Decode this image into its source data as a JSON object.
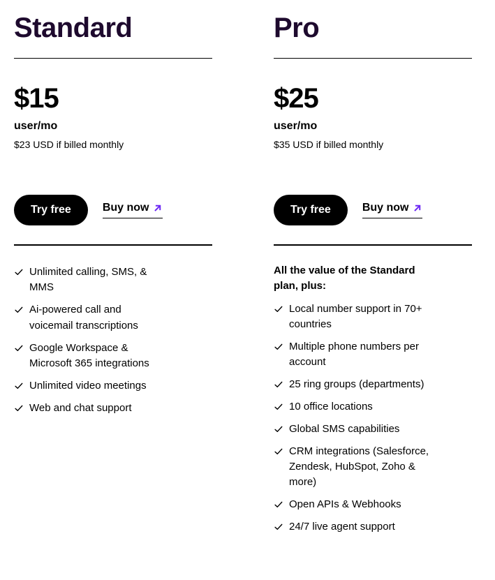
{
  "theme": {
    "background": "#ffffff",
    "heading_color": "#1e0a2e",
    "text_color": "#000000",
    "button_bg": "#000000",
    "button_text": "#ffffff",
    "accent_arrow": "#6d28f5"
  },
  "icons": {
    "check": "check-icon",
    "arrow": "arrow-up-right-icon"
  },
  "plans": [
    {
      "name": "Standard",
      "price": "$15",
      "unit": "user/mo",
      "billing_note": "$23 USD if billed monthly",
      "primary_cta": "Try free",
      "secondary_cta": "Buy now",
      "intro": "",
      "features": [
        "Unlimited calling, SMS, & MMS",
        "Ai-powered call and voicemail transcriptions",
        "Google Workspace & Microsoft 365 integrations",
        "Unlimited video meetings",
        "Web and chat support"
      ]
    },
    {
      "name": "Pro",
      "price": "$25",
      "unit": "user/mo",
      "billing_note": "$35 USD if billed monthly",
      "primary_cta": "Try free",
      "secondary_cta": "Buy now",
      "intro": "All the value of the Standard plan, plus:",
      "features": [
        "Local number support in 70+ countries",
        "Multiple phone numbers per account",
        "25 ring groups (departments)",
        "10 office locations",
        "Global SMS capabilities",
        "CRM integrations (Salesforce, Zendesk, HubSpot, Zoho & more)",
        "Open APIs & Webhooks",
        "24/7 live agent support"
      ]
    }
  ]
}
